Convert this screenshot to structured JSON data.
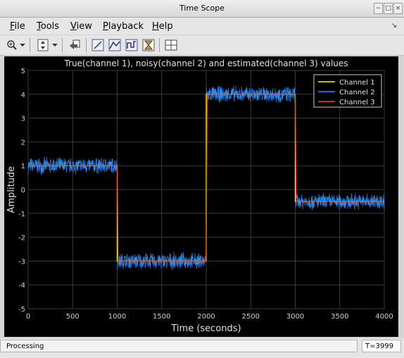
{
  "window": {
    "title": "Time Scope"
  },
  "menu": [
    {
      "label": "File",
      "underline": "F",
      "rest": "ile"
    },
    {
      "label": "Tools",
      "underline": "T",
      "rest": "ools"
    },
    {
      "label": "View",
      "underline": "V",
      "rest": "iew"
    },
    {
      "label": "Playback",
      "underline": "P",
      "rest": "layback"
    },
    {
      "label": "Help",
      "underline": "H",
      "rest": "elp"
    }
  ],
  "toolbar": {
    "icons": [
      "zoom-in-icon",
      "dropdown-arrow-icon",
      "scale-axes-icon",
      "restore-default-view-icon",
      "data-cursors-icon",
      "peak-finder-icon",
      "signal-statistics-icon",
      "bilevel-measurements-icon",
      "layout-icon"
    ]
  },
  "status": {
    "left": "Processing",
    "right": "T=3999"
  },
  "chart_data": {
    "type": "line",
    "title": "True(channel 1), noisy(channel 2) and estimated(channel 3) values",
    "xlabel": "Time (seconds)",
    "ylabel": "Amplitude",
    "xlim": [
      0,
      4000
    ],
    "ylim": [
      -5,
      5
    ],
    "xticks": [
      0,
      500,
      1000,
      1500,
      2000,
      2500,
      3000,
      3500,
      4000
    ],
    "yticks": [
      -5,
      -4,
      -3,
      -2,
      -1,
      0,
      1,
      2,
      3,
      4,
      5
    ],
    "grid": true,
    "legend_position": "top-right",
    "series": [
      {
        "name": "Channel 1",
        "color": "#ffff00",
        "x": [
          0,
          1000,
          1000,
          2000,
          2000,
          3000,
          3000,
          4000
        ],
        "y": [
          1,
          1,
          -3,
          -3,
          4,
          4,
          -0.5,
          -0.5
        ]
      },
      {
        "name": "Channel 2",
        "color": "#1e90ff",
        "x": [
          0,
          1000,
          1000,
          2000,
          2000,
          3000,
          3000,
          4000
        ],
        "y": [
          1,
          1,
          -3,
          -3,
          4,
          4,
          -0.5,
          -0.5
        ],
        "noise_amplitude": 0.3
      },
      {
        "name": "Channel 3",
        "color": "#ff4500",
        "x": [
          0,
          1000,
          1010,
          2000,
          2010,
          3000,
          3010,
          4000
        ],
        "y": [
          1,
          1,
          -3,
          -3,
          4,
          4,
          -0.5,
          -0.5
        ]
      }
    ]
  }
}
